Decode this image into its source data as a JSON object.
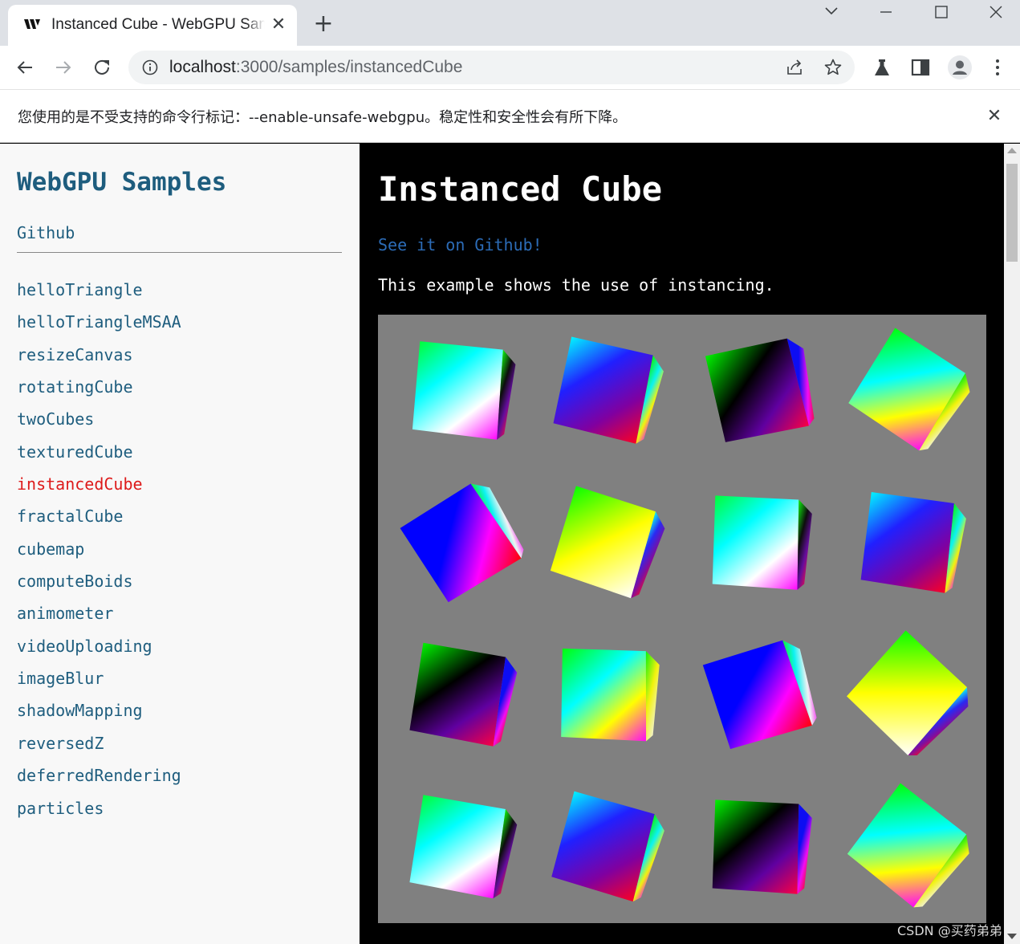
{
  "browser": {
    "tab": {
      "title": "Instanced Cube - WebGPU Samples",
      "favicon": "webgpu-logo-icon"
    },
    "new_tab_label": "+",
    "window_controls": [
      "chevron-down-icon",
      "minimize-icon",
      "maximize-icon",
      "close-icon"
    ],
    "address_bar": {
      "host": "localhost",
      "path": ":3000/samples/instancedCube"
    },
    "toolbar_icons": [
      "share-icon",
      "star-icon",
      "labs-icon",
      "side-panel-icon",
      "profile-icon",
      "menu-icon"
    ],
    "infobar": {
      "message": "您使用的是不受支持的命令行标记：--enable-unsafe-webgpu。稳定性和安全性会有所下降。",
      "close_glyph": "✕"
    }
  },
  "sidebar": {
    "title": "WebGPU Samples",
    "github_label": "Github",
    "samples": [
      {
        "label": "helloTriangle",
        "active": false
      },
      {
        "label": "helloTriangleMSAA",
        "active": false
      },
      {
        "label": "resizeCanvas",
        "active": false
      },
      {
        "label": "rotatingCube",
        "active": false
      },
      {
        "label": "twoCubes",
        "active": false
      },
      {
        "label": "texturedCube",
        "active": false
      },
      {
        "label": "instancedCube",
        "active": true
      },
      {
        "label": "fractalCube",
        "active": false
      },
      {
        "label": "cubemap",
        "active": false
      },
      {
        "label": "computeBoids",
        "active": false
      },
      {
        "label": "animometer",
        "active": false
      },
      {
        "label": "videoUploading",
        "active": false
      },
      {
        "label": "imageBlur",
        "active": false
      },
      {
        "label": "shadowMapping",
        "active": false
      },
      {
        "label": "reversedZ",
        "active": false
      },
      {
        "label": "deferredRendering",
        "active": false
      },
      {
        "label": "particles",
        "active": false
      }
    ]
  },
  "main": {
    "title": "Instanced Cube",
    "github_link": "See it on Github!",
    "description": "This example shows the use of instancing.",
    "canvas": {
      "background": "#808080",
      "grid": {
        "rows": 4,
        "cols": 4
      }
    }
  },
  "watermark": "CSDN @买药弟弟",
  "colors": {
    "link": "#1e5d7e",
    "active_link": "#dd1a1a",
    "github_link": "#2c6cb7",
    "sidebar_bg": "#f8f8f8",
    "main_bg": "#000000"
  }
}
